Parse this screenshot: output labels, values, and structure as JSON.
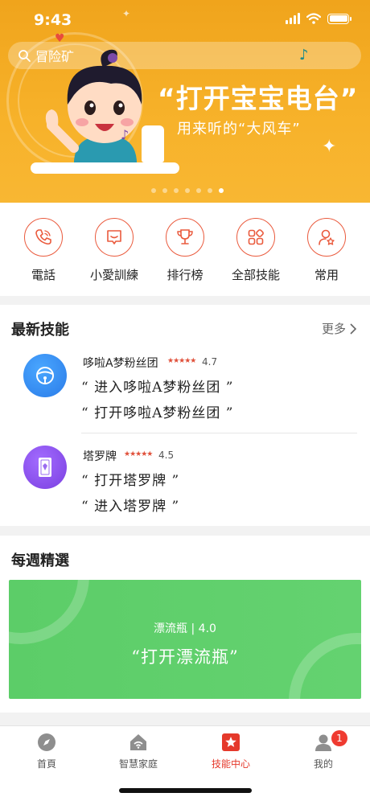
{
  "status_bar": {
    "time": "9:43"
  },
  "search": {
    "placeholder": "冒险矿"
  },
  "banner": {
    "headline": "“打开宝宝电台”",
    "subline": "用来听的“大风车”",
    "page_count": 7,
    "active_page": 6
  },
  "quick_actions": [
    {
      "label": "電話",
      "icon": "phone-icon"
    },
    {
      "label": "小愛訓練",
      "icon": "message-icon"
    },
    {
      "label": "排行榜",
      "icon": "trophy-icon"
    },
    {
      "label": "全部技能",
      "icon": "grid-icon"
    },
    {
      "label": "常用",
      "icon": "user-star-icon"
    }
  ],
  "latest_skills": {
    "title": "最新技能",
    "more_label": "更多",
    "items": [
      {
        "name": "哆啦A梦粉丝团",
        "rating": "4.7",
        "stars": "★★★★★",
        "phrases": [
          "“ 进入哆啦A梦粉丝团 ”",
          "“ 打开哆啦A梦粉丝团 ”"
        ],
        "icon": "bell-icon",
        "color": "#3a8ef0"
      },
      {
        "name": "塔罗牌",
        "rating": "4.5",
        "stars": "★★★★★",
        "phrases": [
          "“ 打开塔罗牌 ”",
          "“ 进入塔罗牌 ”"
        ],
        "icon": "tarot-card-icon",
        "color": "#8a52e6"
      }
    ]
  },
  "weekly": {
    "title": "每週精選",
    "card_sub": "漂流瓶 | 4.0",
    "card_title": "“打开漂流瓶”",
    "color": "#5ccd68"
  },
  "tabs": [
    {
      "label": "首頁",
      "icon": "compass-icon"
    },
    {
      "label": "智慧家庭",
      "icon": "smart-home-icon"
    },
    {
      "label": "技能中心",
      "icon": "skill-star-icon",
      "active": true
    },
    {
      "label": "我的",
      "icon": "profile-icon",
      "badge": "1"
    }
  ],
  "colors": {
    "accent": "#ea5a3d",
    "banner": "#f5ad25",
    "active_tab": "#e5392b"
  }
}
